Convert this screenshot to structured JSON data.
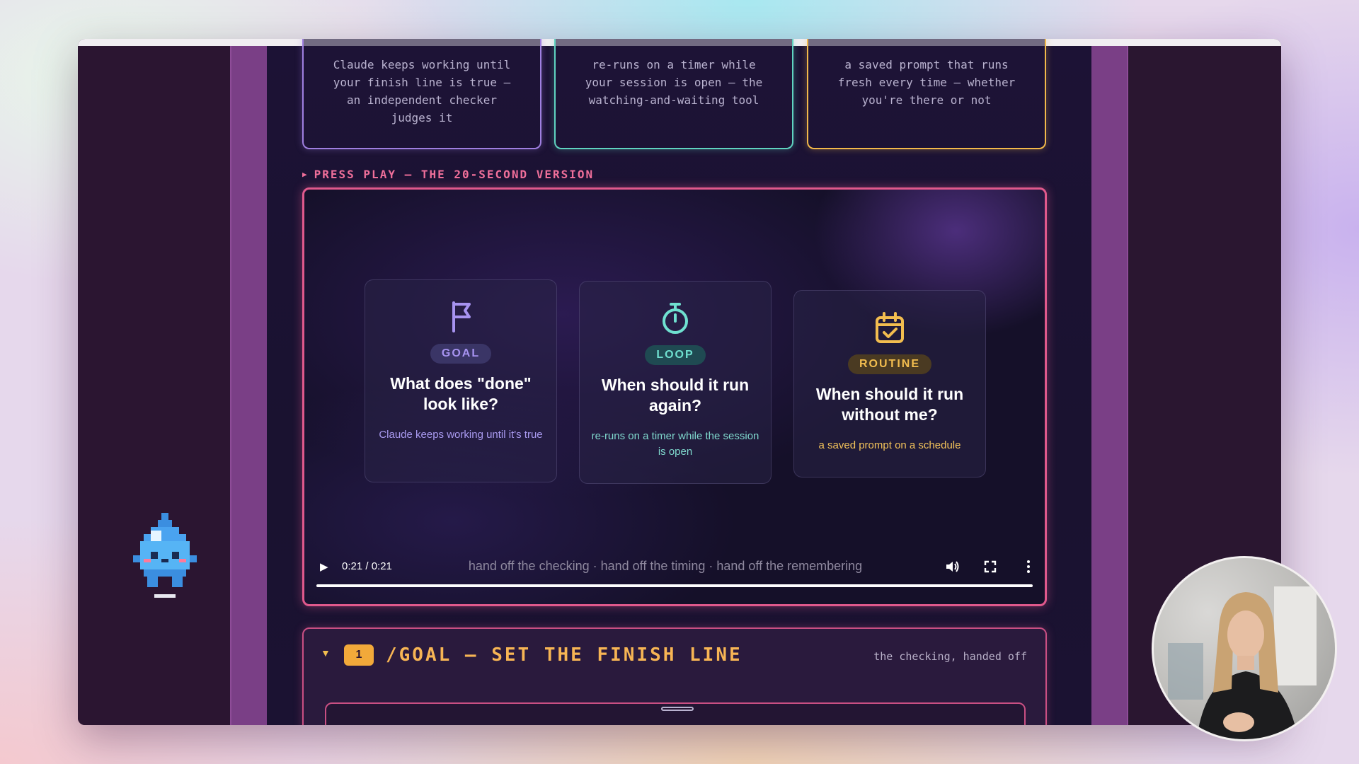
{
  "summary_cards": {
    "goal": [
      "Claude keeps working until",
      "your finish line is true —",
      "an independent checker",
      "judges it"
    ],
    "loop": [
      "re-runs on a timer while",
      "your session is open — the",
      "watching-and-waiting tool"
    ],
    "routine": [
      "a saved prompt that runs",
      "fresh every time — whether",
      "you're there or not"
    ]
  },
  "press_play_label": "PRESS PLAY — THE 20-SECOND VERSION",
  "video": {
    "cards": [
      {
        "icon": "flag-icon",
        "badge": "GOAL",
        "question": "What does \"done\" look like?",
        "description": "Claude keeps working until it's true"
      },
      {
        "icon": "stopwatch-icon",
        "badge": "LOOP",
        "question": "When should it run again?",
        "description": "re-runs on a timer while the session is open"
      },
      {
        "icon": "calendar-check-icon",
        "badge": "ROUTINE",
        "question": "When should it run without me?",
        "description": "a saved prompt on a schedule"
      }
    ],
    "time": "0:21 / 0:21",
    "caption": "hand off the checking · hand off the timing · hand off the remembering",
    "progress": 1.0
  },
  "section": {
    "number": "1",
    "title": "/GOAL — SET THE FINISH LINE",
    "subtitle": "the checking, handed off"
  },
  "colors": {
    "goal": "#a793f0",
    "loop": "#6fe0d0",
    "routine": "#f2bd4f",
    "accent_pink": "#e0598c"
  }
}
